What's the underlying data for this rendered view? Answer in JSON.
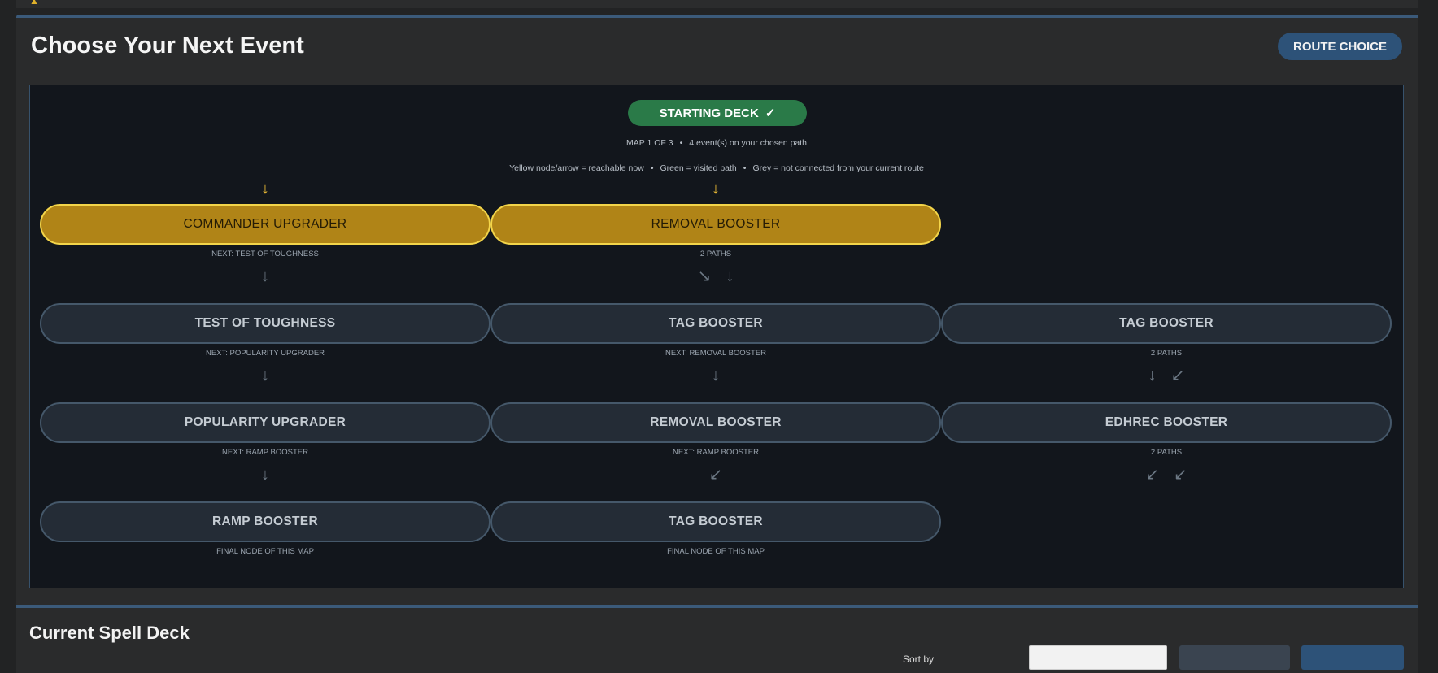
{
  "header": {
    "title": "Choose Your Next Event",
    "route_button": "ROUTE CHOICE"
  },
  "map": {
    "start_label": "STARTING DECK",
    "start_check": "✓",
    "map_info": "MAP 1 OF 3",
    "events_info": "4 event(s) on your chosen path",
    "legend": {
      "yellow": "Yellow node/arrow = reachable now",
      "green": "Green = visited path",
      "grey": "Grey = not connected from your current route"
    },
    "bullet": "•",
    "entry_arrows": {
      "col1": "↓",
      "col2": "↓"
    },
    "rows": [
      {
        "nodes": [
          {
            "label": "COMMANDER UPGRADER",
            "sub": "NEXT: TEST OF TOUGHNESS",
            "arrows": [
              "↓"
            ],
            "state": "reachable"
          },
          {
            "label": "REMOVAL BOOSTER",
            "sub": "2 PATHS",
            "arrows": [
              "↘",
              "↓"
            ],
            "state": "reachable"
          }
        ]
      },
      {
        "nodes": [
          {
            "label": "TEST OF TOUGHNESS",
            "sub": "NEXT: POPULARITY UPGRADER",
            "arrows": [
              "↓"
            ],
            "state": "unconnected"
          },
          {
            "label": "TAG BOOSTER",
            "sub": "NEXT: REMOVAL BOOSTER",
            "arrows": [
              "↓"
            ],
            "state": "unconnected"
          },
          {
            "label": "TAG BOOSTER",
            "sub": "2 PATHS",
            "arrows": [
              "↓",
              "↙"
            ],
            "state": "unconnected"
          }
        ]
      },
      {
        "nodes": [
          {
            "label": "POPULARITY UPGRADER",
            "sub": "NEXT: RAMP BOOSTER",
            "arrows": [
              "↓"
            ],
            "state": "unconnected"
          },
          {
            "label": "REMOVAL BOOSTER",
            "sub": "NEXT: RAMP BOOSTER",
            "arrows": [
              "↙"
            ],
            "state": "unconnected"
          },
          {
            "label": "EDHREC BOOSTER",
            "sub": "2 PATHS",
            "arrows": [
              "↙",
              "↙"
            ],
            "state": "unconnected"
          }
        ]
      },
      {
        "nodes": [
          {
            "label": "RAMP BOOSTER",
            "sub": "FINAL NODE OF THIS MAP",
            "state": "unconnected"
          },
          {
            "label": "TAG BOOSTER",
            "sub": "FINAL NODE OF THIS MAP",
            "state": "unconnected"
          }
        ]
      }
    ]
  },
  "deck": {
    "title": "Current Spell Deck",
    "sort_label": "Sort by"
  },
  "colors": {
    "accent": "#2d5278",
    "reachable": "#b08417",
    "reachable_border": "#f3d54a",
    "visited": "#2a7a48",
    "unconnected": "#242c36"
  }
}
